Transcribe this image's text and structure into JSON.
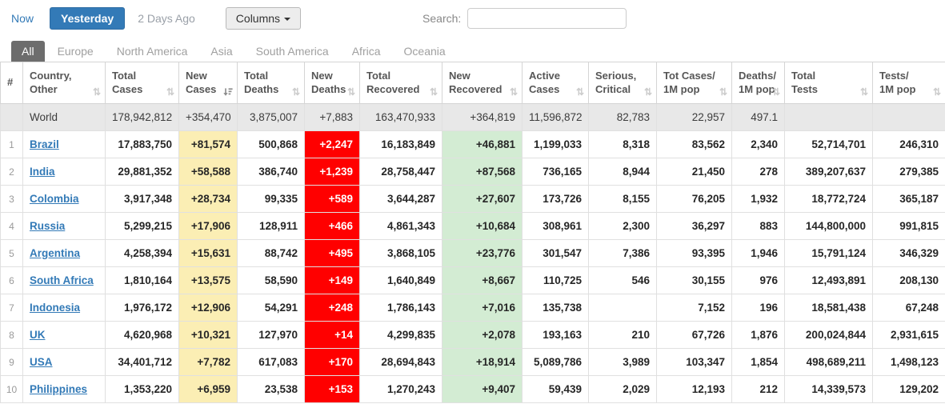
{
  "toolbar": {
    "now": "Now",
    "yesterday": "Yesterday",
    "two_days_ago": "2 Days Ago",
    "columns_label": "Columns",
    "search_label": "Search:",
    "search_value": ""
  },
  "continent_tabs": [
    {
      "label": "All",
      "active": true
    },
    {
      "label": "Europe",
      "active": false
    },
    {
      "label": "North America",
      "active": false
    },
    {
      "label": "Asia",
      "active": false
    },
    {
      "label": "South America",
      "active": false
    },
    {
      "label": "Africa",
      "active": false
    },
    {
      "label": "Oceania",
      "active": false
    }
  ],
  "icons": {
    "columns_caret": "caret-down",
    "sort_unsorted": "up-down-arrows",
    "sort_active": "sort-amount-desc"
  },
  "colors": {
    "accent_blue": "#337ab7",
    "active_tab_gray": "#6d6d6d",
    "new_cases_bg": "#fbeeb4",
    "new_deaths_bg": "#ff0000",
    "new_recovered_bg": "#d3ecd3",
    "world_row_bg": "#e8e8e8"
  },
  "table": {
    "columns": [
      {
        "key": "rank",
        "label1": "#",
        "label2": "",
        "sort": null
      },
      {
        "key": "country",
        "label1": "Country,",
        "label2": "Other",
        "sort": "unsorted"
      },
      {
        "key": "total_cases",
        "label1": "Total",
        "label2": "Cases",
        "sort": "unsorted"
      },
      {
        "key": "new_cases",
        "label1": "New",
        "label2": "Cases",
        "sort": "desc"
      },
      {
        "key": "total_deaths",
        "label1": "Total",
        "label2": "Deaths",
        "sort": "unsorted"
      },
      {
        "key": "new_deaths",
        "label1": "New",
        "label2": "Deaths",
        "sort": "unsorted"
      },
      {
        "key": "total_recovered",
        "label1": "Total",
        "label2": "Recovered",
        "sort": "unsorted"
      },
      {
        "key": "new_recovered",
        "label1": "New",
        "label2": "Recovered",
        "sort": "unsorted"
      },
      {
        "key": "active_cases",
        "label1": "Active",
        "label2": "Cases",
        "sort": "unsorted"
      },
      {
        "key": "serious_critical",
        "label1": "Serious,",
        "label2": "Critical",
        "sort": "unsorted"
      },
      {
        "key": "cases_per_1m",
        "label1": "Tot Cases/",
        "label2": "1M pop",
        "sort": "unsorted"
      },
      {
        "key": "deaths_per_1m",
        "label1": "Deaths/",
        "label2": "1M pop",
        "sort": "unsorted"
      },
      {
        "key": "total_tests",
        "label1": "Total",
        "label2": "Tests",
        "sort": "unsorted"
      },
      {
        "key": "tests_per_1m",
        "label1": "Tests/",
        "label2": "1M pop",
        "sort": "unsorted"
      }
    ],
    "world_row": {
      "rank": "",
      "country": "World",
      "values": [
        "178,942,812",
        "+354,470",
        "3,875,007",
        "+7,883",
        "163,470,933",
        "+364,819",
        "11,596,872",
        "82,783",
        "22,957",
        "497.1",
        "",
        ""
      ]
    },
    "rows": [
      {
        "rank": "1",
        "country": "Brazil",
        "values": [
          "17,883,750",
          "+81,574",
          "500,868",
          "+2,247",
          "16,183,849",
          "+46,881",
          "1,199,033",
          "8,318",
          "83,562",
          "2,340",
          "52,714,701",
          "246,310"
        ]
      },
      {
        "rank": "2",
        "country": "India",
        "values": [
          "29,881,352",
          "+58,588",
          "386,740",
          "+1,239",
          "28,758,447",
          "+87,568",
          "736,165",
          "8,944",
          "21,450",
          "278",
          "389,207,637",
          "279,385"
        ]
      },
      {
        "rank": "3",
        "country": "Colombia",
        "values": [
          "3,917,348",
          "+28,734",
          "99,335",
          "+589",
          "3,644,287",
          "+27,607",
          "173,726",
          "8,155",
          "76,205",
          "1,932",
          "18,772,724",
          "365,187"
        ]
      },
      {
        "rank": "4",
        "country": "Russia",
        "values": [
          "5,299,215",
          "+17,906",
          "128,911",
          "+466",
          "4,861,343",
          "+10,684",
          "308,961",
          "2,300",
          "36,297",
          "883",
          "144,800,000",
          "991,815"
        ]
      },
      {
        "rank": "5",
        "country": "Argentina",
        "values": [
          "4,258,394",
          "+15,631",
          "88,742",
          "+495",
          "3,868,105",
          "+23,776",
          "301,547",
          "7,386",
          "93,395",
          "1,946",
          "15,791,124",
          "346,329"
        ]
      },
      {
        "rank": "6",
        "country": "South Africa",
        "values": [
          "1,810,164",
          "+13,575",
          "58,590",
          "+149",
          "1,640,849",
          "+8,667",
          "110,725",
          "546",
          "30,155",
          "976",
          "12,493,891",
          "208,130"
        ]
      },
      {
        "rank": "7",
        "country": "Indonesia",
        "values": [
          "1,976,172",
          "+12,906",
          "54,291",
          "+248",
          "1,786,143",
          "+7,016",
          "135,738",
          "",
          "7,152",
          "196",
          "18,581,438",
          "67,248"
        ]
      },
      {
        "rank": "8",
        "country": "UK",
        "values": [
          "4,620,968",
          "+10,321",
          "127,970",
          "+14",
          "4,299,835",
          "+2,078",
          "193,163",
          "210",
          "67,726",
          "1,876",
          "200,024,844",
          "2,931,615"
        ]
      },
      {
        "rank": "9",
        "country": "USA",
        "values": [
          "34,401,712",
          "+7,782",
          "617,083",
          "+170",
          "28,694,843",
          "+18,914",
          "5,089,786",
          "3,989",
          "103,347",
          "1,854",
          "498,689,211",
          "1,498,123"
        ]
      },
      {
        "rank": "10",
        "country": "Philippines",
        "values": [
          "1,353,220",
          "+6,959",
          "23,538",
          "+153",
          "1,270,243",
          "+9,407",
          "59,439",
          "2,029",
          "12,193",
          "212",
          "14,339,573",
          "129,202"
        ]
      }
    ]
  }
}
